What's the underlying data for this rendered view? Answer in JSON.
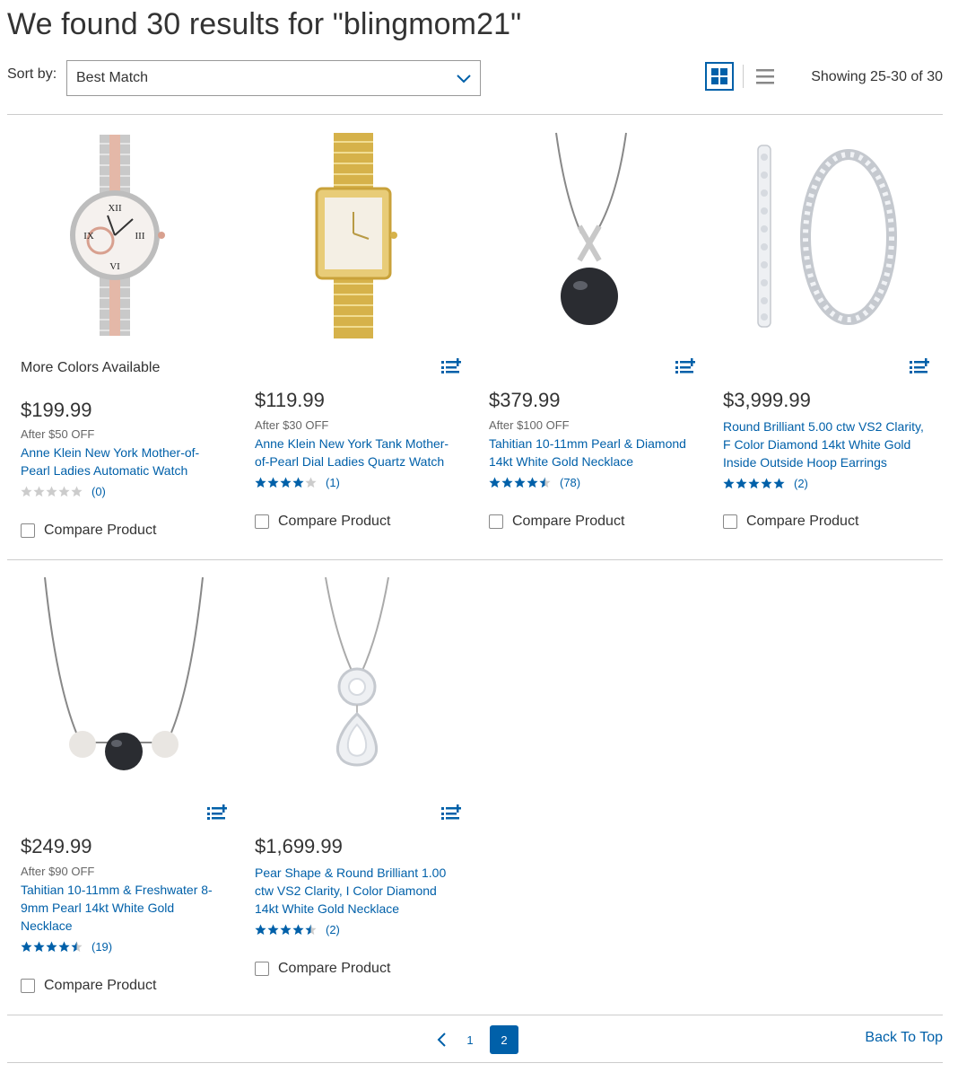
{
  "header": {
    "title": "We found 30 results for \"blingmom21\""
  },
  "toolbar": {
    "sort_label": "Sort by:",
    "sort_value": "Best Match",
    "showing": "Showing 25-30 of 30"
  },
  "colors": {
    "link": "#0060a9",
    "star": "#0060a9",
    "star_empty": "#ccc"
  },
  "products": [
    {
      "more_colors": "More Colors Available",
      "price": "$199.99",
      "discount": "After $50 OFF",
      "title": "Anne Klein New York Mother-of-Pearl Ladies Automatic Watch",
      "rating": 0,
      "review_count": "(0)",
      "compare_label": "Compare Product",
      "image": "rose-silver-watch"
    },
    {
      "price": "$119.99",
      "discount": "After $30 OFF",
      "title": "Anne Klein New York Tank Mother-of-Pearl Dial Ladies Quartz Watch",
      "rating": 4,
      "review_count": "(1)",
      "compare_label": "Compare Product",
      "image": "gold-tank-watch"
    },
    {
      "price": "$379.99",
      "discount": "After $100 OFF",
      "title": "Tahitian 10-11mm Pearl & Diamond 14kt White Gold Necklace",
      "rating": 4.5,
      "review_count": "(78)",
      "compare_label": "Compare Product",
      "image": "black-pearl-pendant"
    },
    {
      "price": "$3,999.99",
      "title": "Round Brilliant 5.00 ctw VS2 Clarity, F Color Diamond 14kt White Gold Inside Outside Hoop Earrings",
      "rating": 5,
      "review_count": "(2)",
      "compare_label": "Compare Product",
      "image": "diamond-hoop-earrings"
    },
    {
      "price": "$249.99",
      "discount": "After $90 OFF",
      "title": "Tahitian 10-11mm & Freshwater 8-9mm Pearl 14kt White Gold Necklace",
      "rating": 4.5,
      "review_count": "(19)",
      "compare_label": "Compare Product",
      "image": "three-pearl-necklace"
    },
    {
      "price": "$1,699.99",
      "title": "Pear Shape & Round Brilliant 1.00 ctw VS2 Clarity, I Color Diamond 14kt White Gold Necklace",
      "rating": 4.5,
      "review_count": "(2)",
      "compare_label": "Compare Product",
      "image": "diamond-drop-necklace"
    }
  ],
  "pagination": {
    "pages": [
      "1",
      "2"
    ],
    "current": "2"
  },
  "footer": {
    "back_to_top": "Back To Top"
  }
}
